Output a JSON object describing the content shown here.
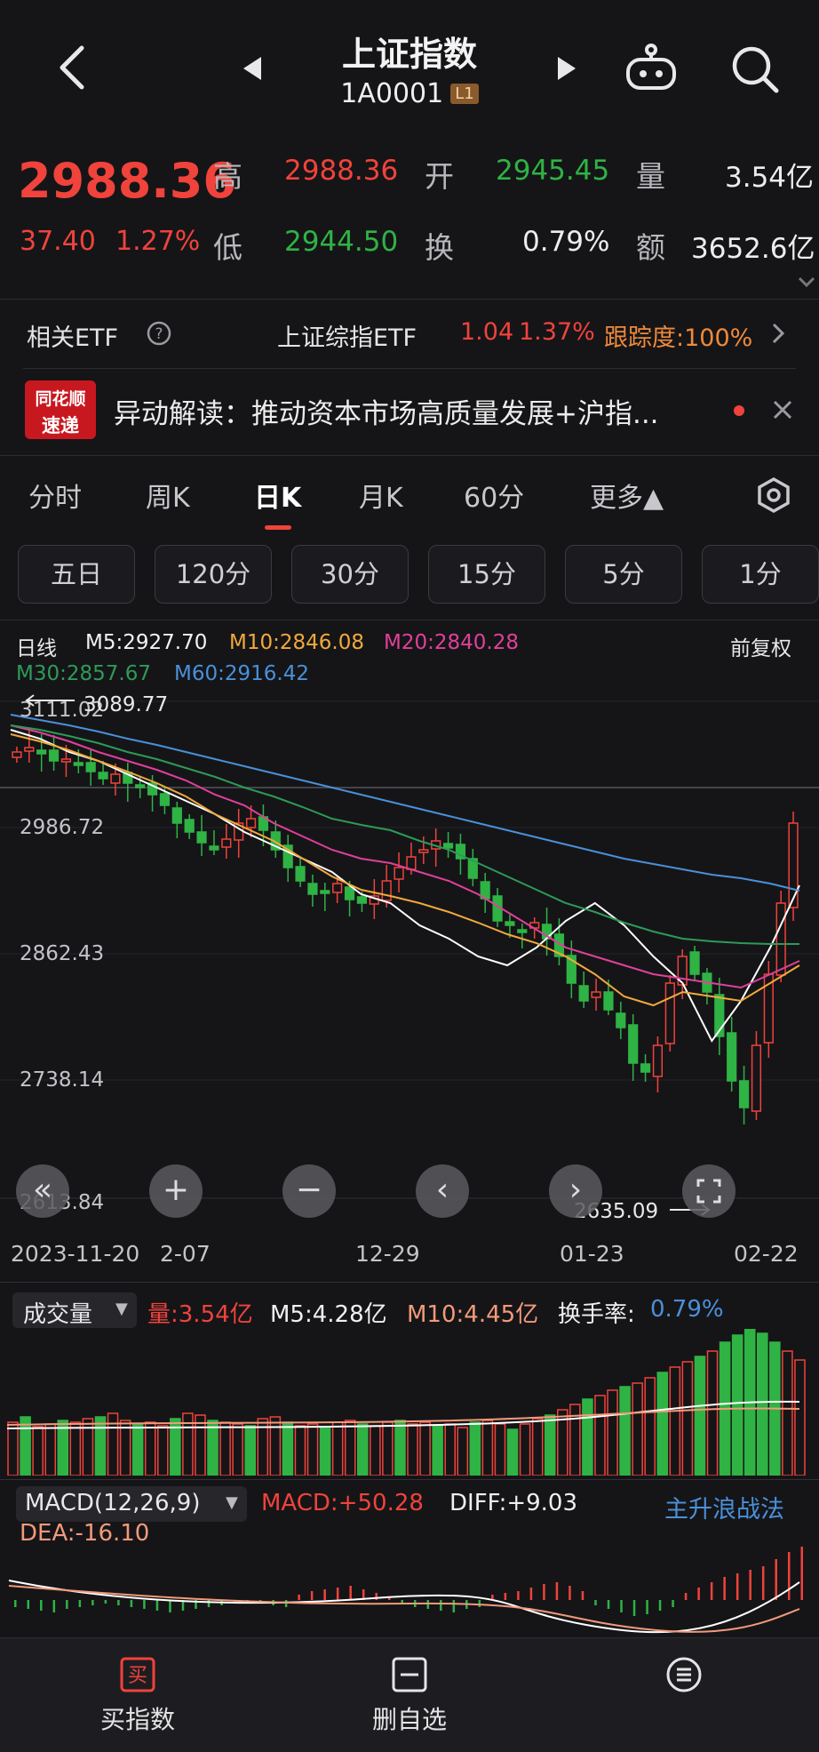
{
  "header": {
    "title": "上证指数",
    "code": "1A0001",
    "level_badge": "L1"
  },
  "quote": {
    "price": "2988.36",
    "change": "37.40",
    "change_pct": "1.27%",
    "high_label": "高",
    "high": "2988.36",
    "low_label": "低",
    "low": "2944.50",
    "open_label": "开",
    "open": "2945.45",
    "turnover_label": "换",
    "turnover": "0.79%",
    "volume_label": "量",
    "volume": "3.54亿",
    "amount_label": "额",
    "amount": "3652.6亿"
  },
  "etf": {
    "label": "相关ETF",
    "name": "上证综指ETF",
    "price": "1.04",
    "pct": "1.37%",
    "tracking": "跟踪度:100%"
  },
  "news": {
    "logo_top": "同花顺",
    "logo_bottom": "速递",
    "text": "异动解读：推动资本市场高质量发展+沪指..."
  },
  "tabs": [
    {
      "label": "分时"
    },
    {
      "label": "周K"
    },
    {
      "label": "日K"
    },
    {
      "label": "月K"
    },
    {
      "label": "60分"
    },
    {
      "label": "更多▲"
    }
  ],
  "periods": [
    {
      "label": "五日"
    },
    {
      "label": "120分"
    },
    {
      "label": "30分"
    },
    {
      "label": "15分"
    },
    {
      "label": "5分"
    },
    {
      "label": "1分"
    }
  ],
  "kline": {
    "period": "日线",
    "m5": "M5:2927.70",
    "m10": "M10:2846.08",
    "m20": "M20:2840.28",
    "m30": "M30:2857.67",
    "m60": "M60:2916.42",
    "adjust": "前复权",
    "y_labels": [
      "3111.02",
      "2986.72",
      "2862.43",
      "2738.14",
      "2613.84"
    ],
    "high_marker": "3089.77",
    "low_marker": "2635.09",
    "x_labels": [
      "2023-11-20",
      "2-07",
      "12-29",
      "01-23",
      "02-22"
    ],
    "colors": {
      "m5": "#ffffff",
      "m10": "#f2a93b",
      "m20": "#e0409a",
      "m30": "#2e9a57",
      "m60": "#4a90d9",
      "up": "#f0433b",
      "down": "#2fb344"
    }
  },
  "volume": {
    "title": "成交量",
    "vol": "量:3.54亿",
    "m5": "M5:4.28亿",
    "m10": "M10:4.45亿",
    "turnover_label": "换手率:",
    "turnover": "0.79%"
  },
  "macd": {
    "title": "MACD(12,26,9)",
    "macd": "MACD:+50.28",
    "diff": "DIFF:+9.03",
    "dea": "DEA:-16.10",
    "strategy": "主升浪战法"
  },
  "bottom": {
    "buy": "买指数",
    "buy_icon_char": "买",
    "remove": "删自选"
  }
}
